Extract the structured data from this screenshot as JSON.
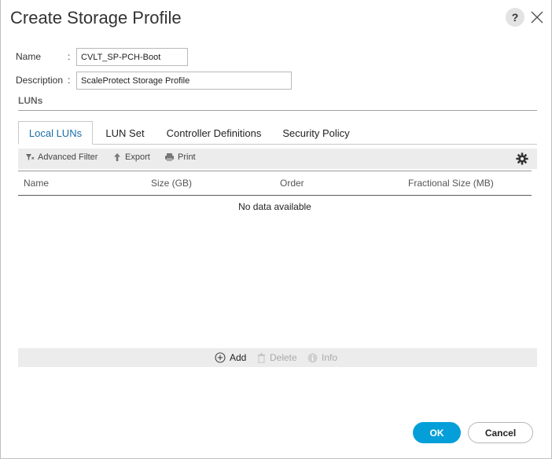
{
  "dialog": {
    "title": "Create Storage Profile",
    "help_label": "?"
  },
  "form": {
    "name_label": "Name",
    "name_colon": ":",
    "name_value": "CVLT_SP-PCH-Boot",
    "description_label": "Description",
    "description_colon": ":",
    "description_value": "ScaleProtect Storage Profile"
  },
  "section": {
    "title": "LUNs"
  },
  "tabs": [
    {
      "label": "Local LUNs",
      "active": true
    },
    {
      "label": "LUN Set",
      "active": false
    },
    {
      "label": "Controller Definitions",
      "active": false
    },
    {
      "label": "Security Policy",
      "active": false
    }
  ],
  "toolbar": {
    "advanced_filter": "Advanced Filter",
    "export": "Export",
    "print": "Print"
  },
  "table": {
    "columns": [
      "Name",
      "Size (GB)",
      "Order",
      "Fractional Size (MB)"
    ],
    "empty_text": "No data available"
  },
  "actions": {
    "add": "Add",
    "delete": "Delete",
    "info": "Info"
  },
  "footer": {
    "ok": "OK",
    "cancel": "Cancel"
  },
  "colors": {
    "accent": "#049fd9",
    "active_tab_text": "#1a6fa8"
  }
}
